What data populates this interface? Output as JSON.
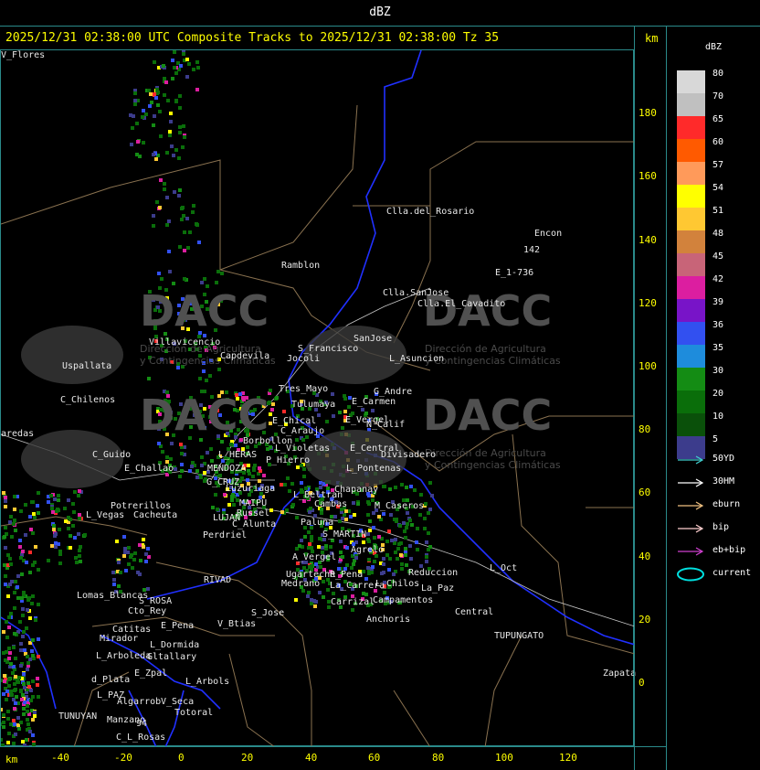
{
  "unit_title": "dBZ",
  "header": "2025/12/31 02:38:00 UTC Composite Tracks to 2025/12/31 02:38:00 Tz 35",
  "axis_unit": "km",
  "y_ticks": [
    "180",
    "160",
    "140",
    "120",
    "100",
    "80",
    "60",
    "40",
    "20",
    "0"
  ],
  "x_ticks": [
    "-40",
    "-20",
    "0",
    "20",
    "40",
    "60",
    "80",
    "100",
    "120"
  ],
  "legend": {
    "title": "dBZ",
    "levels": [
      {
        "label": "80",
        "color": "#d8d8d8"
      },
      {
        "label": "70",
        "color": "#c0c0c0"
      },
      {
        "label": "65",
        "color": "#ff2a2a"
      },
      {
        "label": "60",
        "color": "#ff5a00"
      },
      {
        "label": "57",
        "color": "#ff9a5a"
      },
      {
        "label": "54",
        "color": "#ffff00"
      },
      {
        "label": "51",
        "color": "#ffc832"
      },
      {
        "label": "48",
        "color": "#d2823c"
      },
      {
        "label": "45",
        "color": "#c86478"
      },
      {
        "label": "42",
        "color": "#dc1ea0"
      },
      {
        "label": "39",
        "color": "#7814c8"
      },
      {
        "label": "36",
        "color": "#3250f0"
      },
      {
        "label": "35",
        "color": "#1e8cdc"
      },
      {
        "label": "30",
        "color": "#148c14"
      },
      {
        "label": "20",
        "color": "#0a6e0a"
      },
      {
        "label": "10",
        "color": "#0a500a"
      },
      {
        "label": "5",
        "color": "#3c3c8c"
      }
    ],
    "tracks": [
      {
        "label": "50YD",
        "color": "#40d0d0"
      },
      {
        "label": "30HM",
        "color": "#ffffff"
      },
      {
        "label": "eburn",
        "color": "#f0c080"
      },
      {
        "label": "bip",
        "color": "#ffd0d0"
      },
      {
        "label": "eb+bip",
        "color": "#d040d0"
      },
      {
        "label": "current",
        "color": "#00e0e0"
      }
    ]
  },
  "watermark": {
    "brand": "DACC",
    "line1": "Dirección de Agricultura",
    "line2": "y Contingencias Climáticas"
  },
  "places": [
    {
      "name": "Clla.del_Rosario"
    },
    {
      "name": "Encon"
    },
    {
      "name": "142"
    },
    {
      "name": "E_1-736"
    },
    {
      "name": "Ramblon"
    },
    {
      "name": "Clla.SanJose"
    },
    {
      "name": "Clla.El_Cavadito"
    },
    {
      "name": "Villavicencio"
    },
    {
      "name": "Capdevila"
    },
    {
      "name": "S_Francisco"
    },
    {
      "name": "Jocoli"
    },
    {
      "name": "SanJose"
    },
    {
      "name": "L_Asuncion"
    },
    {
      "name": "Uspallata"
    },
    {
      "name": "Tres_Mayo"
    },
    {
      "name": "G_Andre"
    },
    {
      "name": "C_Chilenos"
    },
    {
      "name": "Tulumaya"
    },
    {
      "name": "E_Carmen"
    },
    {
      "name": "aredas"
    },
    {
      "name": "E_Chical"
    },
    {
      "name": "C_Araujo"
    },
    {
      "name": "E_Vergel"
    },
    {
      "name": "N_Calif"
    },
    {
      "name": "Borbollon"
    },
    {
      "name": "L_Violetas"
    },
    {
      "name": "E_Central"
    },
    {
      "name": "C_Guido"
    },
    {
      "name": "L_HERAS"
    },
    {
      "name": "P_Hierro"
    },
    {
      "name": "Divisadero"
    },
    {
      "name": "E_Challao"
    },
    {
      "name": "MENDOZA"
    },
    {
      "name": "L_Pontenas"
    },
    {
      "name": "G_CRUZ"
    },
    {
      "name": "Luzuriaga"
    },
    {
      "name": "Chapanay"
    },
    {
      "name": "L_Beltran"
    },
    {
      "name": "Potrerillos"
    },
    {
      "name": "MAIPU"
    },
    {
      "name": "Russel"
    },
    {
      "name": "Cambas"
    },
    {
      "name": "M_Caseros"
    },
    {
      "name": "L_Vegas"
    },
    {
      "name": "Cacheuta"
    },
    {
      "name": "LUJAN"
    },
    {
      "name": "C_Alunta"
    },
    {
      "name": "Paluna"
    },
    {
      "name": "Perdriel"
    },
    {
      "name": "S_MARTIN"
    },
    {
      "name": "Agrelo"
    },
    {
      "name": "A_Vergel"
    },
    {
      "name": "R_Pena"
    },
    {
      "name": "RIVAD"
    },
    {
      "name": "Ugarteche"
    },
    {
      "name": "Medrano"
    },
    {
      "name": "Reduccion"
    },
    {
      "name": "L_Oct"
    },
    {
      "name": "Lomas_Blancas"
    },
    {
      "name": "La_Carrera"
    },
    {
      "name": "L_Chilos"
    },
    {
      "name": "La_Paz"
    },
    {
      "name": "S_ROSA"
    },
    {
      "name": "Cto_Rey"
    },
    {
      "name": "S_Jose"
    },
    {
      "name": "Carrizal"
    },
    {
      "name": "Campamentos"
    },
    {
      "name": "Central"
    },
    {
      "name": "Catitas"
    },
    {
      "name": "E_Pena"
    },
    {
      "name": "V_Btias"
    },
    {
      "name": "Anchoris"
    },
    {
      "name": "Mirador"
    },
    {
      "name": "TUPUNGATO"
    },
    {
      "name": "L_Dormida"
    },
    {
      "name": "L_Arboleda"
    },
    {
      "name": "Gltallary"
    },
    {
      "name": "E_Zpal"
    },
    {
      "name": "d_Plata"
    },
    {
      "name": "L_Arbols"
    },
    {
      "name": "Zapata"
    },
    {
      "name": "L_PAZ"
    },
    {
      "name": "Algarrob"
    },
    {
      "name": "V_Seca"
    },
    {
      "name": "Totoral"
    },
    {
      "name": "TUNUYAN"
    },
    {
      "name": "Manzano"
    },
    {
      "name": "94"
    },
    {
      "name": "C_L_Rosas"
    },
    {
      "name": "V_Flores"
    }
  ]
}
